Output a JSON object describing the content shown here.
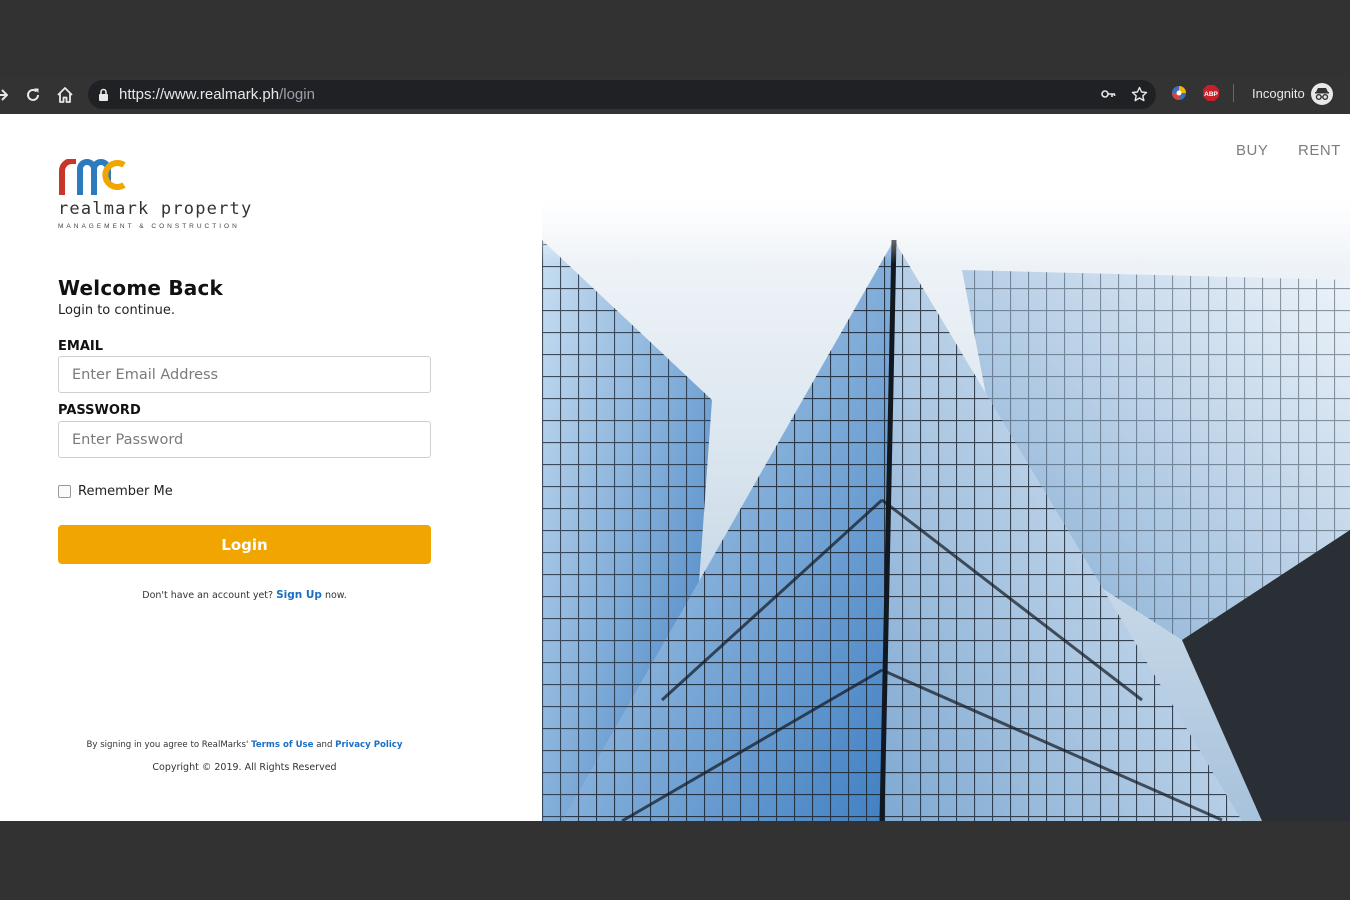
{
  "browser": {
    "url_host": "https://www.realmark.ph",
    "url_path": "/login",
    "incognito_label": "Incognito",
    "extension_badge": "ABP",
    "icons": [
      "forward-icon",
      "reload-icon",
      "home-icon",
      "lock-icon",
      "key-icon",
      "star-icon",
      "extension-icon",
      "adblock-icon",
      "incognito-icon"
    ]
  },
  "header": {
    "nav": [
      {
        "label": "BUY"
      },
      {
        "label": "RENT"
      }
    ]
  },
  "brand": {
    "name": "realmark property",
    "tagline": "MANAGEMENT & CONSTRUCTION",
    "logo_letters": "rmc",
    "colors": {
      "r": "#c8352a",
      "m": "#2b7bbd",
      "c": "#f0a500"
    }
  },
  "login": {
    "title": "Welcome Back",
    "subtitle": "Login to continue.",
    "email_label": "EMAIL",
    "email_placeholder": "Enter Email Address",
    "password_label": "PASSWORD",
    "password_placeholder": "Enter Password",
    "remember_label": "Remember Me",
    "remember_checked": false,
    "submit_label": "Login",
    "signup_prefix": "Don't have an account yet? ",
    "signup_link": "Sign Up",
    "signup_suffix": " now."
  },
  "footer": {
    "agree_prefix": "By signing in you agree to RealMarks' ",
    "terms_link": "Terms of Use",
    "agree_and": " and ",
    "privacy_link": "Privacy Policy",
    "copyright": "Copyright © 2019. All Rights Reserved"
  },
  "theme": {
    "accent": "#f0a500",
    "link": "#1a6fc4",
    "chrome_bg": "#323232"
  }
}
